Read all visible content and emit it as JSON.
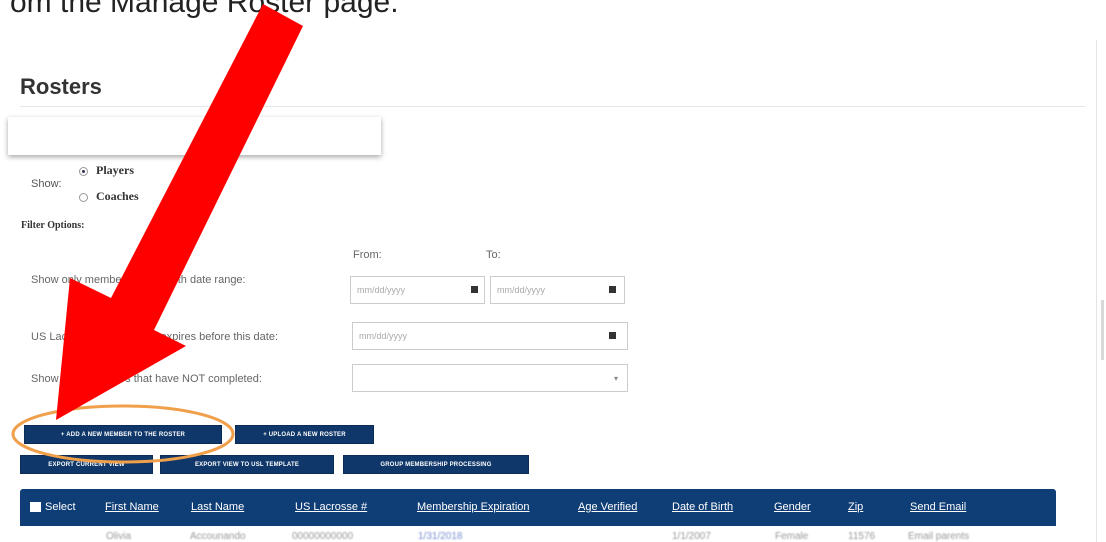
{
  "caption": "om the Manage Roster page.",
  "page_title": "Rosters",
  "show": {
    "label": "Show:",
    "options": [
      "Players",
      "Coaches"
    ],
    "selected": "Players"
  },
  "filter": {
    "title": "Filter Options:",
    "birth_range_label": "Show only members in this birth date range:",
    "from_label": "From:",
    "to_label": "To:",
    "from_placeholder": "mm/dd/yyyy",
    "to_placeholder": "mm/dd/yyyy",
    "expires_label": "US Lacrosse membership expires before this date:",
    "expires_placeholder": "mm/dd/yyyy",
    "not_completed_label": "Show only members that have NOT completed:",
    "not_completed_value": ""
  },
  "buttons": {
    "add_member": "+ ADD A NEW MEMBER TO THE ROSTER",
    "upload_roster": "+ UPLOAD A NEW ROSTER",
    "export_current": "EXPORT CURRENT VIEW",
    "export_usl": "EXPORT VIEW TO USL TEMPLATE",
    "group_membership": "GROUP MEMBERSHIP PROCESSING"
  },
  "table": {
    "columns": [
      "Select",
      "First Name",
      "Last Name",
      "US Lacrosse #",
      "Membership Expiration",
      "Age Verified",
      "Date of Birth",
      "Gender",
      "Zip",
      "Send Email"
    ],
    "rows": [
      [
        "",
        "Olivia",
        "Accounando",
        "00000000000",
        "1/31/2018",
        "",
        "1/1/2007",
        "Female",
        "11576",
        "Email parents"
      ]
    ]
  },
  "colors": {
    "header_blue": "#0f3d75",
    "button_blue": "#0f3769",
    "arrow_red": "#ff0000",
    "highlight_orange": "#f0a04b"
  },
  "icons": [
    "calendar-icon",
    "dropdown-caret-icon",
    "radio-icon",
    "checkbox-icon",
    "email-icon"
  ]
}
